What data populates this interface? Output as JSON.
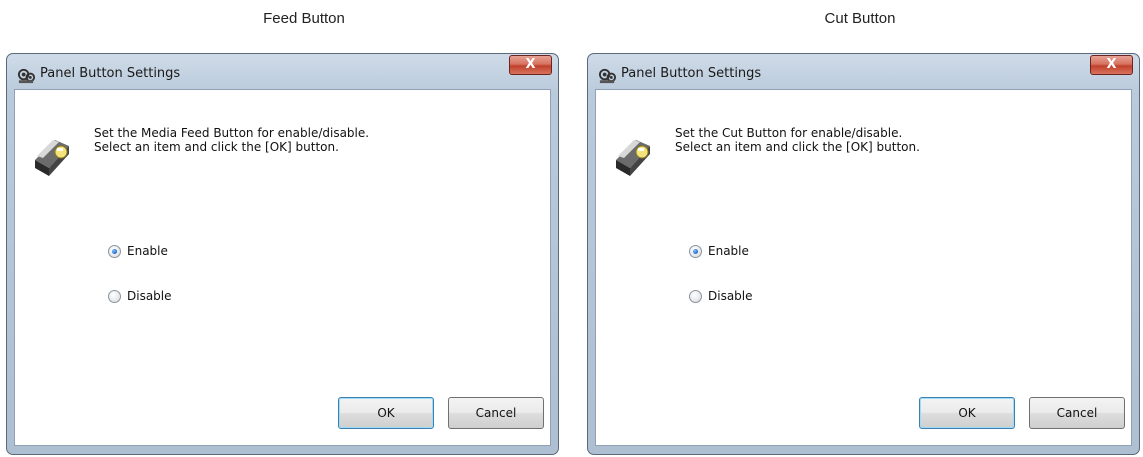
{
  "captions": [
    "Feed Button",
    "Cut Button"
  ],
  "dialogs": [
    {
      "title": "Panel Button Settings",
      "close_label": "X",
      "message_line1": "Set the Media Feed Button for enable/disable.",
      "message_line2": "Select an item and click the [OK] button.",
      "options": [
        "Enable",
        "Disable"
      ],
      "selected": "Enable",
      "ok_label": "OK",
      "cancel_label": "Cancel"
    },
    {
      "title": "Panel Button Settings",
      "close_label": "X",
      "message_line1": "Set the Cut Button for enable/disable.",
      "message_line2": "Select an item and click the [OK] button.",
      "options": [
        "Enable",
        "Disable"
      ],
      "selected": "Enable",
      "ok_label": "OK",
      "cancel_label": "Cancel"
    }
  ],
  "colors": {
    "frame": "#b9cadb",
    "close_button": "#c0412c",
    "default_button_border": "#3c7fb1",
    "radio_selected": "#1f66c9"
  },
  "icons": [
    "printer-settings-icon",
    "printer-button-icon"
  ]
}
